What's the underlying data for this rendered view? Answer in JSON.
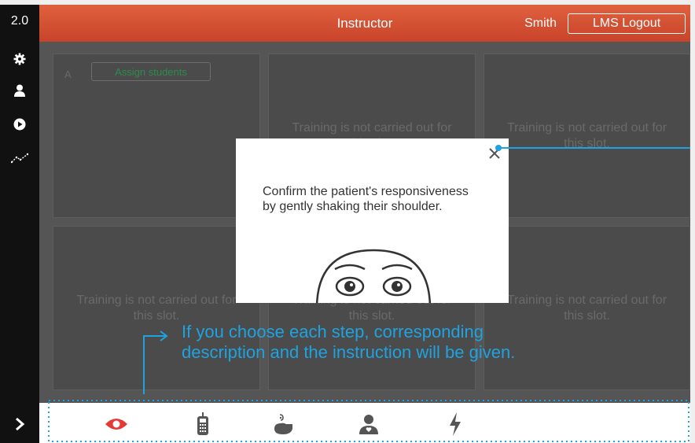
{
  "app": {
    "version": "2.0",
    "title": "Instructor",
    "user": "Smith",
    "logout_label": "LMS Logout"
  },
  "sidebar": {
    "icons": [
      "gear-icon",
      "person-icon",
      "play-icon",
      "chart-trend-icon"
    ],
    "expand_icon": "chevron-right-icon"
  },
  "slots": [
    {
      "letter": "A",
      "assign_label": "Assign students",
      "message": ""
    },
    {
      "letter": "",
      "assign_label": "",
      "message": "Training is not carried out for this slot."
    },
    {
      "letter": "",
      "assign_label": "",
      "message": "Training is not carried out for this slot."
    },
    {
      "letter": "",
      "assign_label": "",
      "message": "Training is not carried out for this slot."
    },
    {
      "letter": "",
      "assign_label": "",
      "message": "Training is not carried out for this slot."
    },
    {
      "letter": "",
      "assign_label": "",
      "message": "Training is not carried out for this slot."
    }
  ],
  "steps": [
    {
      "icon": "eye-icon",
      "active": true
    },
    {
      "icon": "phone-icon",
      "active": false
    },
    {
      "icon": "breathing-icon",
      "active": false
    },
    {
      "icon": "chest-compression-icon",
      "active": false
    },
    {
      "icon": "lightning-icon",
      "active": false
    }
  ],
  "modal": {
    "text": "Confirm the patient's responsiveness by gently shaking their shoulder.",
    "close_icon": "close-icon"
  },
  "callout": {
    "line1": "If you choose each step, corresponding",
    "line2": "description and the instruction will be given."
  },
  "colors": {
    "header": "#d65235",
    "accent": "#1fa3e0",
    "active_step": "#e53935",
    "sidebar": "#111111"
  }
}
